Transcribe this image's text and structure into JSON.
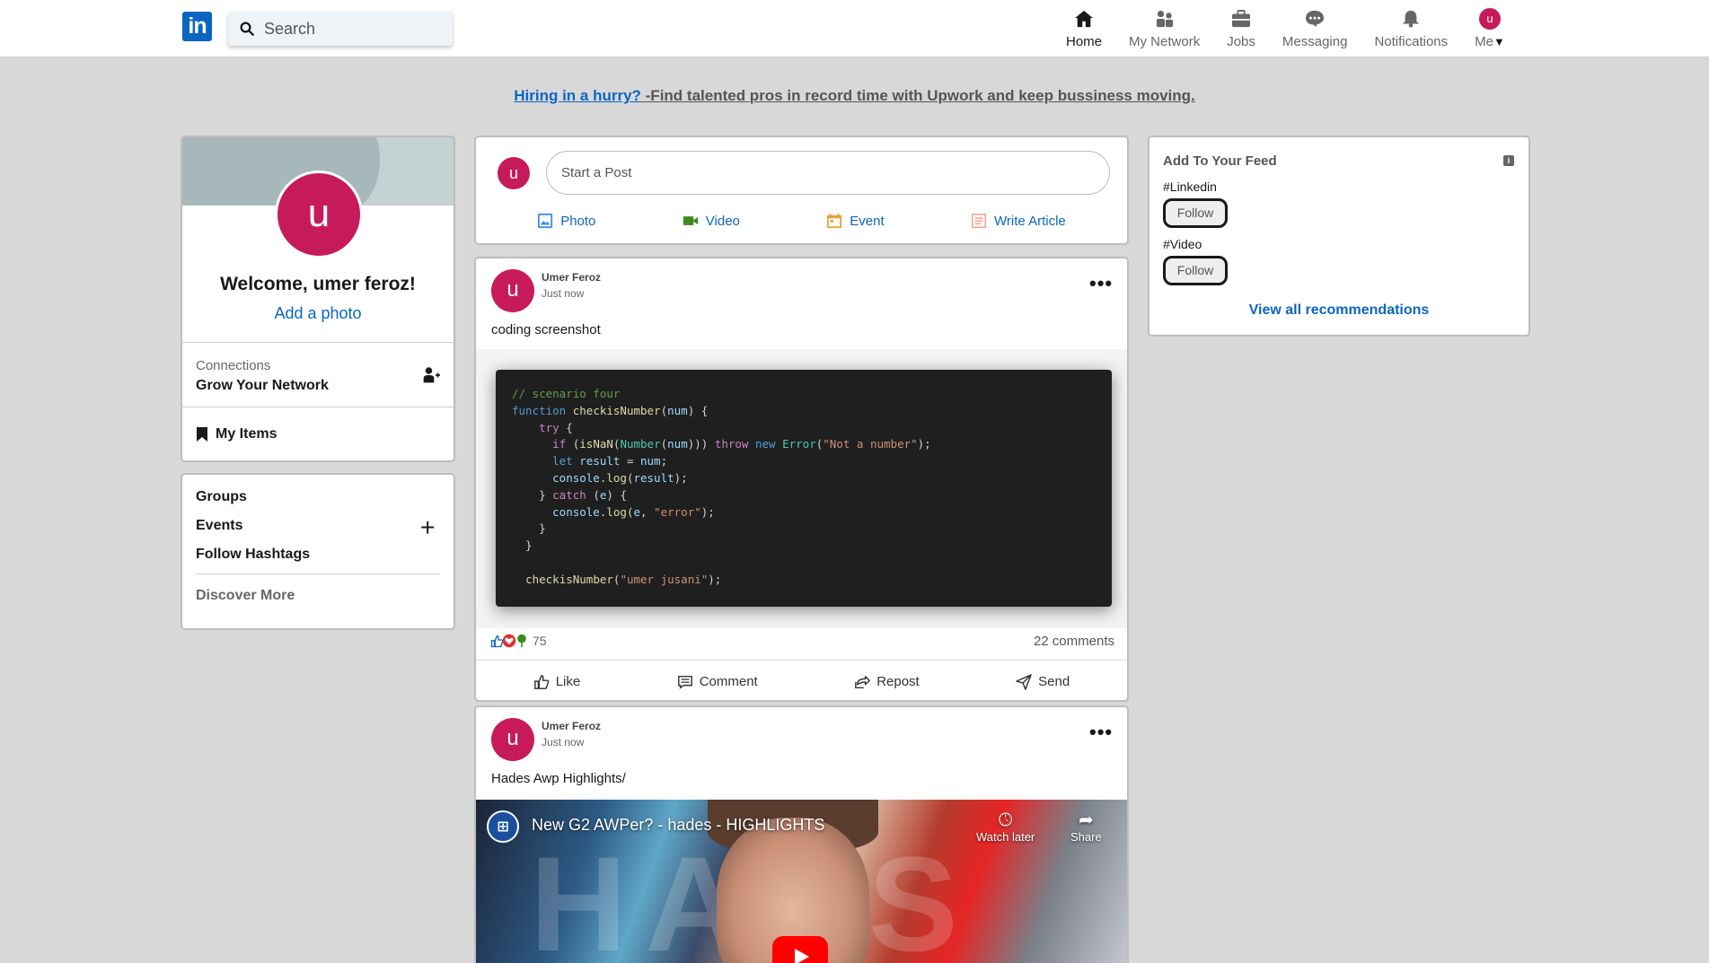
{
  "nav": {
    "search_placeholder": "Search",
    "items": [
      {
        "label": "Home",
        "icon": "home-icon"
      },
      {
        "label": "My Network",
        "icon": "network-icon"
      },
      {
        "label": "Jobs",
        "icon": "briefcase-icon"
      },
      {
        "label": "Messaging",
        "icon": "message-icon"
      },
      {
        "label": "Notifications",
        "icon": "bell-icon"
      }
    ],
    "me_label": "Me",
    "me_avatar": "u",
    "logo_text": "in"
  },
  "banner": {
    "link": "Hiring in a hurry?",
    "text": " -Find talented pros in record time with Upwork and keep bussiness moving."
  },
  "profile": {
    "avatar": "u",
    "welcome": "Welcome, umer feroz!",
    "add_photo": "Add a photo",
    "connections_label": "Connections",
    "connections_value": "Grow Your Network",
    "my_items": "My Items"
  },
  "groups": {
    "items": [
      "Groups",
      "Events",
      "Follow Hashtags"
    ],
    "discover": "Discover More"
  },
  "composer": {
    "avatar": "u",
    "placeholder": "Start a Post",
    "actions": [
      "Photo",
      "Video",
      "Event",
      "Write Article"
    ]
  },
  "posts": [
    {
      "avatar": "u",
      "author": "Umer Feroz",
      "time": "Just now",
      "text": "coding screenshot",
      "reaction_count": "75",
      "comments": "22 comments",
      "actions": [
        "Like",
        "Comment",
        "Repost",
        "Send"
      ]
    },
    {
      "avatar": "u",
      "author": "Umer Feroz",
      "time": "Just now",
      "text": "Hades Awp Highlights/",
      "video_title": "New G2 AWPer? - hades - HIGHLIGHTS",
      "watch_later": "Watch later",
      "share": "Share"
    }
  ],
  "feed": {
    "title": "Add To Your Feed",
    "tags": [
      "#Linkedin",
      "#Video"
    ],
    "follow": "Follow",
    "view_all": "View all recommendations"
  },
  "colors": {
    "accent": "#0a66c2",
    "avatar": "#c71a5a",
    "page_bg": "#d8d8d8"
  }
}
